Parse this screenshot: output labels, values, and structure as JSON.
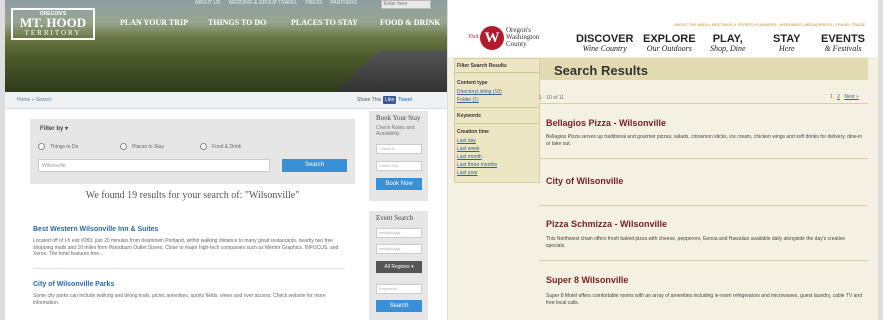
{
  "left_site": {
    "top_links": [
      "ABOUT US",
      "WEDDING & GROUP TRAVEL",
      "PRESS",
      "PARTNERS"
    ],
    "top_search_placeholder": "Enter here",
    "logo": {
      "line1": "OREGON'S",
      "line2": "MT. HOOD",
      "line3": "TERRITORY"
    },
    "nav": [
      "PLAN YOUR TRIP",
      "THINGS TO DO",
      "PLACES TO STAY",
      "FOOD & DRINK"
    ],
    "breadcrumb": "Home » Search",
    "share": {
      "label": "Share This",
      "like": "Like",
      "tweet": "Tweet"
    },
    "filter": {
      "title": "Filter by ▾",
      "options": [
        "Things to Do",
        "Places to Stay",
        "Food & Drink"
      ],
      "input_value": "Wilsonville",
      "button": "Search"
    },
    "found_text": "We found 19 results for your search of: \"Wilsonville\"",
    "results": [
      {
        "title": "Best Western Wilsonville Inn & Suites",
        "desc": "Located off of I-5 exit #283, just 20 minutes from downtown Portland, within walking distance to many great restaurants, nearby two free shopping malls and 10 miles from Woodburn Outlet Stores. Close to major high-tech companies such as Mentor Graphics, INFOCUS, and Xerox. The hotel features free..."
      },
      {
        "title": "City of Wilsonville Parks",
        "desc": "Some city parks can include walking and biking trails, picnic amenities, sports fields, views and river access. Check website for more information."
      }
    ],
    "book": {
      "title": "Book Your Stay",
      "subtitle": "Check Rates and Availability",
      "check_in": "Check In",
      "check_out": "Check Out",
      "button": "Book Now"
    },
    "event": {
      "title": "Event Search",
      "date1": "mm/dd/yyyy",
      "date2": "mm/dd/yyyy",
      "regions": "All Regions ▾",
      "keywords": "Keywords",
      "button": "Search"
    }
  },
  "right_site": {
    "visit": "Visit",
    "logo_letter": "W",
    "logo_text": [
      "Oregon's",
      "Washington",
      "County"
    ],
    "top_links": "ABOUT THE AREA | MEETINGS & SPORTS PLANNERS | WEDDINGS | MEDIA/PRESS | TRAVEL TRADE",
    "nav": [
      {
        "main": "DISCOVER",
        "sub": "Wine Country"
      },
      {
        "main": "EXPLORE",
        "sub": "Our Outdoors"
      },
      {
        "main": "PLAY,",
        "sub": "Shop, Dine"
      },
      {
        "main": "STAY",
        "sub": "Here"
      },
      {
        "main": "EVENTS",
        "sub": "& Festivals"
      }
    ],
    "sidebar": {
      "title": "Filter Search Results",
      "content_type": "Content type",
      "types": [
        "DirectoryListing (10)",
        "Folder (1)"
      ],
      "keywords": "Keywords",
      "creation": "Creation time",
      "times": [
        "Last day",
        "Last week",
        "Last month",
        "Last three months",
        "Last year"
      ]
    },
    "page_title": "Search Results",
    "count": "1 - 10 of 11",
    "pages": {
      "p1": "1",
      "p2": "2",
      "next": "Next »"
    },
    "results": [
      {
        "title": "Bellagios Pizza - Wilsonville",
        "desc": "Bellagios Pizza serves up traditional and gourmet pizzas, salads, cinnamon sticks, ice cream, chicken wings and soft drinks for delivery, dine-in or take out."
      },
      {
        "title": "City of Wilsonville",
        "desc": ""
      },
      {
        "title": "Pizza Schmizza - Wilsonville",
        "desc": "This Northwest chain offers fresh baked pizza with cheese, pepperoni, Genoa and Hawaiian available daily alongside the day's creative specials."
      },
      {
        "title": "Super 8 Wilsonville",
        "desc": "Super 8 Motel offers comfortable rooms with an array of amenities including in-room refrigerators and microwaves, guest laundry, cable TV and free local calls."
      }
    ]
  }
}
